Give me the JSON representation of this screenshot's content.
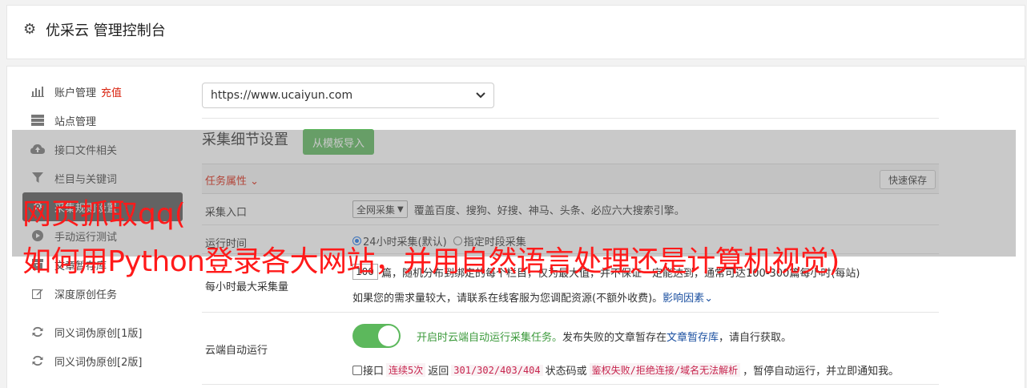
{
  "header": {
    "title": "优采云 管理控制台"
  },
  "sidebar": {
    "items": [
      {
        "label": "账户管理",
        "extra": "充值",
        "icon": "bar-chart-icon"
      },
      {
        "label": "站点管理",
        "extra": "",
        "icon": "server-icon"
      },
      {
        "label": "接口文件相关",
        "extra": "",
        "icon": "cloud-upload-icon"
      },
      {
        "label": "栏目与关键词",
        "extra": "",
        "icon": "filter-icon"
      },
      {
        "label": "采集规则设置",
        "extra": "",
        "icon": "gears-icon"
      },
      {
        "label": "手动运行测试",
        "extra": "",
        "icon": "play-icon"
      },
      {
        "label": "文章暂存库",
        "extra": "",
        "icon": "archive-icon"
      },
      {
        "label": "深度原创任务",
        "extra": "",
        "icon": "edit-icon"
      },
      {
        "label": "同义词伪原创[1版]",
        "extra": "",
        "icon": "refresh-icon"
      },
      {
        "label": "同义词伪原创[2版]",
        "extra": "",
        "icon": "refresh-icon"
      }
    ]
  },
  "site_select": {
    "value": "https://www.ucaiyun.com"
  },
  "collect": {
    "title": "采集细节设置",
    "template_button": "从模板导入",
    "task_attr": "任务属性",
    "quick_save": "快速保存",
    "entry_label": "采集入口",
    "entry_select": "全网采集",
    "entry_desc": "覆盖百度、搜狗、好搜、神马、头条、必应六大搜索引擎。",
    "run_time_label": "运行时间",
    "run_time_opt1": "24小时采集(默认)",
    "run_time_opt2": "指定时段采集",
    "max_label": "每小时最大采集量",
    "max_value": "100",
    "max_desc": "篇，随机分布到绑定的每个栏目，仅为最大值，并不保证一定能达到，通常可达100-300篇每小时(每站)",
    "max_hint": "如果您的需求量较大，请联系在线客服为您调配资源(不额外收费)。",
    "max_link": "影响因素",
    "cloud_label": "云端自动运行",
    "cloud_desc_green": "开启时云端自动运行采集任务。",
    "cloud_desc_1": "发布失败的文章暂存在",
    "cloud_desc_link": "文章暂存库",
    "cloud_desc_2": "，请自行获取。",
    "cloud_check_1": "接口",
    "cloud_code_1": "连续5次",
    "cloud_check_2": "返回",
    "cloud_code_2": "301/302/403/404",
    "cloud_check_3": "状态码或",
    "cloud_code_3": "鉴权失败/拒绝连接/域名无法解析",
    "cloud_check_4": "，暂停自动运行，并立即通知我。"
  },
  "overlay": {
    "line1": "网页抓取qq(",
    "line2": "如何用Python登录各大网站，并用自然语言处理还是计算机视觉)"
  }
}
